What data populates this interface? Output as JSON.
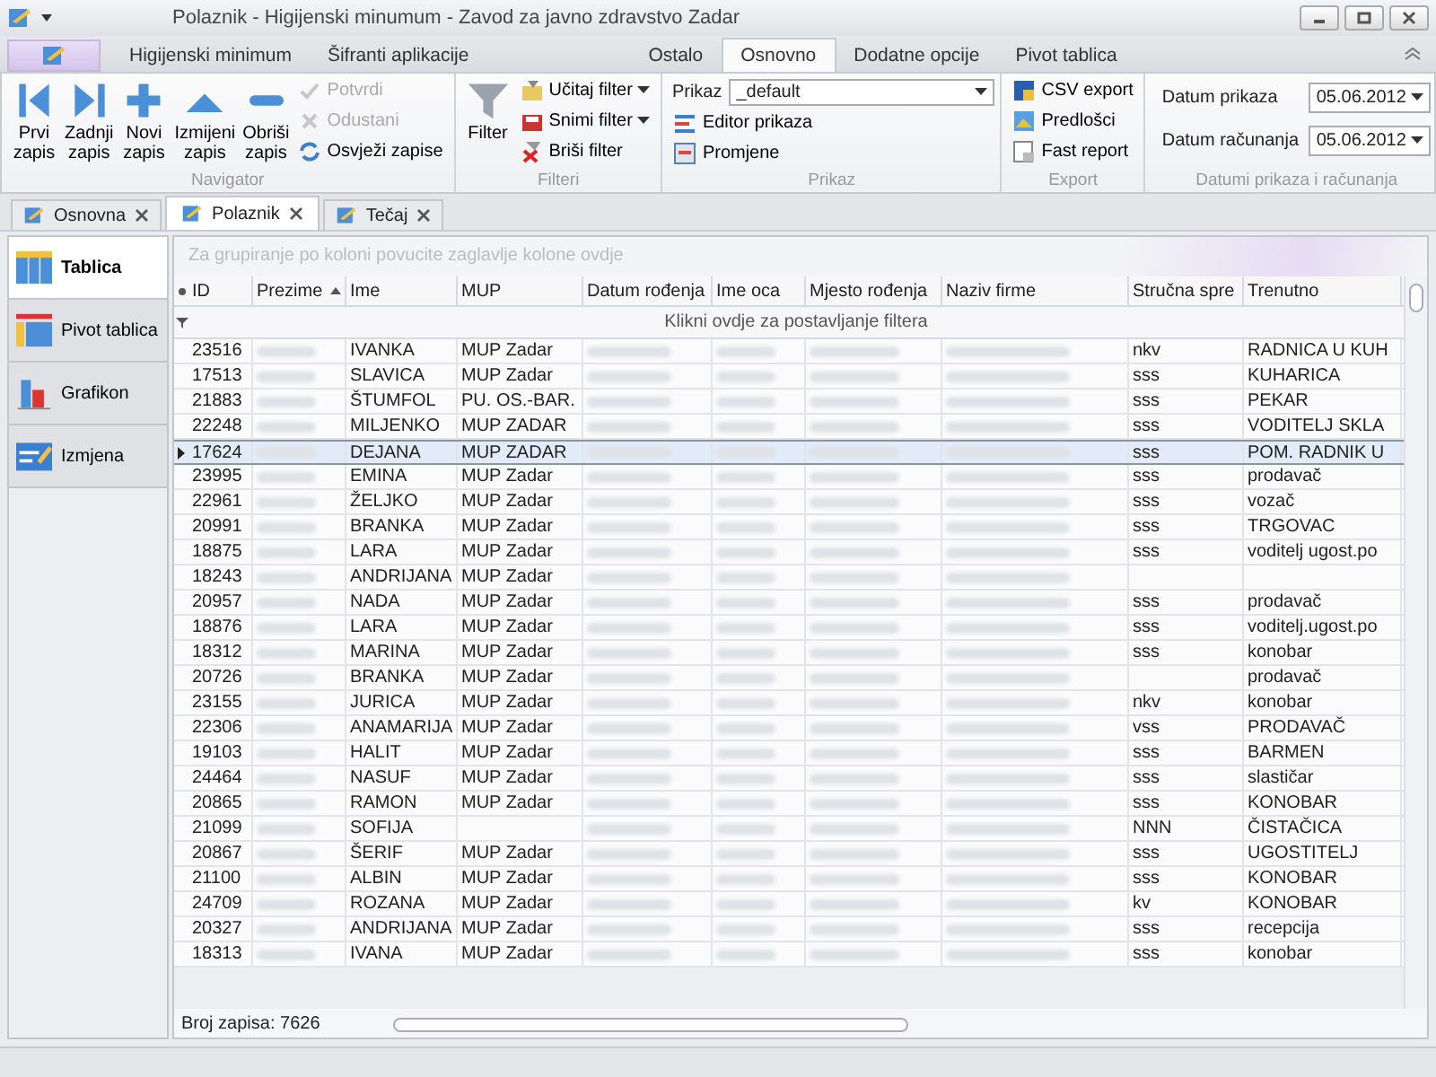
{
  "window": {
    "title": "Polaznik - Higijenski minumum - Zavod za javno zdravstvo Zadar"
  },
  "ribbon_tabs": [
    {
      "label": "Higijenski minimum",
      "selected": false
    },
    {
      "label": "Šifranti aplikacije",
      "selected": false
    },
    {
      "label": "Ostalo",
      "selected": false
    },
    {
      "label": "Osnovno",
      "selected": true
    },
    {
      "label": "Dodatne opcije",
      "selected": false
    },
    {
      "label": "Pivot tablica",
      "selected": false
    }
  ],
  "ribbon_groups": [
    {
      "title": "Navigator",
      "items": [
        {
          "kind": "large",
          "label": "Prvi\nzapis",
          "disabled": false
        },
        {
          "kind": "large",
          "label": "Zadnji\nzapis",
          "disabled": false
        },
        {
          "kind": "large",
          "label": "Novi\nzapis",
          "disabled": false
        },
        {
          "kind": "large",
          "label": "Izmijeni\nzapis",
          "disabled": false
        },
        {
          "kind": "large",
          "label": "Obriši\nzapis",
          "disabled": false
        },
        {
          "kind": "small",
          "label": "Potvrdi",
          "disabled": true
        },
        {
          "kind": "small",
          "label": "Odustani",
          "disabled": true
        },
        {
          "kind": "small",
          "label": "Osvježi zapise",
          "disabled": false
        }
      ]
    },
    {
      "title": "Filteri",
      "items": [
        {
          "kind": "large",
          "label": "Filter",
          "disabled": false
        },
        {
          "kind": "menu",
          "label": "Učitaj filter",
          "disabled": false
        },
        {
          "kind": "menu",
          "label": "Snimi filter",
          "disabled": false
        },
        {
          "kind": "small",
          "label": "Briši filter",
          "disabled": false
        }
      ]
    },
    {
      "title": "Prikaz",
      "items": [
        {
          "kind": "combo",
          "label": "Prikaz",
          "value": "_default",
          "disabled": false
        },
        {
          "kind": "small",
          "label": "Editor prikaza",
          "disabled": false
        },
        {
          "kind": "small",
          "label": "Promjene",
          "disabled": false
        }
      ]
    },
    {
      "title": "Export",
      "items": [
        {
          "kind": "small",
          "label": "CSV export",
          "disabled": false
        },
        {
          "kind": "small",
          "label": "Predlošci",
          "disabled": false
        },
        {
          "kind": "small",
          "label": "Fast report",
          "disabled": false
        }
      ]
    },
    {
      "title": "Datumi prikaza i računanja",
      "items": [
        {
          "kind": "date",
          "label": "Datum prikaza",
          "value": "05.06.2012",
          "disabled": false
        },
        {
          "kind": "date",
          "label": "Datum računanja",
          "value": "05.06.2012",
          "disabled": false
        }
      ]
    }
  ],
  "document_tabs": [
    {
      "label": "Osnovna",
      "selected": false
    },
    {
      "label": "Polaznik",
      "selected": true
    },
    {
      "label": "Tečaj",
      "selected": false
    }
  ],
  "view_buttons": [
    {
      "label": "Tablica",
      "selected": true
    },
    {
      "label": "Pivot tablica",
      "selected": false
    },
    {
      "label": "Grafikon",
      "selected": false
    },
    {
      "label": "Izmjena",
      "selected": false
    }
  ],
  "grid": {
    "group_panel": "Za grupiranje po koloni povucite zaglavlje kolone ovdje",
    "filter_row": "Klikni ovdje za postavljanje filtera",
    "columns": [
      {
        "label": "ID",
        "masked": false,
        "sorted": false
      },
      {
        "label": "Prezime",
        "masked": true,
        "sorted": true
      },
      {
        "label": "Ime",
        "masked": false,
        "sorted": false
      },
      {
        "label": "MUP",
        "masked": false,
        "sorted": false
      },
      {
        "label": "Datum rođenja",
        "masked": true,
        "sorted": false
      },
      {
        "label": "Ime oca",
        "masked": true,
        "sorted": false
      },
      {
        "label": "Mjesto rođenja",
        "masked": true,
        "sorted": false
      },
      {
        "label": "Naziv firme",
        "masked": true,
        "sorted": false
      },
      {
        "label": "Stručna spre",
        "masked": false,
        "sorted": false
      },
      {
        "label": "Trenutno",
        "masked": false,
        "sorted": false
      }
    ],
    "rows": [
      {
        "selected": false,
        "cells": [
          "23516",
          "",
          "IVANKA",
          "MUP Zadar",
          "",
          "",
          "",
          "",
          "nkv",
          "RADNICA U KUH"
        ]
      },
      {
        "selected": false,
        "cells": [
          "17513",
          "",
          "SLAVICA",
          "MUP Zadar",
          "",
          "",
          "",
          "",
          "sss",
          "KUHARICA"
        ]
      },
      {
        "selected": false,
        "cells": [
          "21883",
          "",
          "ŠTUMFOL",
          "PU. OS.-BAR.",
          "",
          "",
          "",
          "",
          "sss",
          "PEKAR"
        ]
      },
      {
        "selected": false,
        "cells": [
          "22248",
          "",
          "MILJENKO",
          "MUP ZADAR",
          "",
          "",
          "",
          "",
          "sss",
          "VODITELJ SKLA"
        ]
      },
      {
        "selected": true,
        "cells": [
          "17624",
          "",
          "DEJANA",
          "MUP  ZADAR",
          "",
          "",
          "",
          "",
          "sss",
          "POM. RADNIK U"
        ]
      },
      {
        "selected": false,
        "cells": [
          "23995",
          "",
          "EMINA",
          "MUP Zadar",
          "",
          "",
          "",
          "",
          "sss",
          "prodavač"
        ]
      },
      {
        "selected": false,
        "cells": [
          "22961",
          "",
          "ŽELJKO",
          "MUP Zadar",
          "",
          "",
          "",
          "",
          "sss",
          "vozač"
        ]
      },
      {
        "selected": false,
        "cells": [
          "20991",
          "",
          "BRANKA",
          "MUP Zadar",
          "",
          "",
          "",
          "",
          "sss",
          "TRGOVAC"
        ]
      },
      {
        "selected": false,
        "cells": [
          "18875",
          "",
          "LARA",
          "MUP Zadar",
          "",
          "",
          "",
          "",
          "sss",
          "voditelj ugost.po"
        ]
      },
      {
        "selected": false,
        "cells": [
          "18243",
          "",
          "ANDRIJANA",
          "MUP Zadar",
          "",
          "",
          "",
          "",
          "",
          ""
        ]
      },
      {
        "selected": false,
        "cells": [
          "20957",
          "",
          "NADA",
          "MUP Zadar",
          "",
          "",
          "",
          "",
          "sss",
          "prodavač"
        ]
      },
      {
        "selected": false,
        "cells": [
          "18876",
          "",
          "LARA",
          "MUP Zadar",
          "",
          "",
          "",
          "",
          "sss",
          "voditelj.ugost.po"
        ]
      },
      {
        "selected": false,
        "cells": [
          "18312",
          "",
          "MARINA",
          "MUP Zadar",
          "",
          "",
          "",
          "",
          "sss",
          "konobar"
        ]
      },
      {
        "selected": false,
        "cells": [
          "20726",
          "",
          "BRANKA",
          "MUP Zadar",
          "",
          "",
          "",
          "",
          "",
          "prodavač"
        ]
      },
      {
        "selected": false,
        "cells": [
          "23155",
          "",
          "JURICA",
          "MUP Zadar",
          "",
          "",
          "",
          "",
          "nkv",
          "konobar"
        ]
      },
      {
        "selected": false,
        "cells": [
          "22306",
          "",
          "ANAMARIJA",
          "MUP Zadar",
          "",
          "",
          "",
          "",
          "vss",
          "PRODAVAČ"
        ]
      },
      {
        "selected": false,
        "cells": [
          "19103",
          "",
          "HALIT",
          "MUP Zadar",
          "",
          "",
          "",
          "",
          "sss",
          "BARMEN"
        ]
      },
      {
        "selected": false,
        "cells": [
          "24464",
          "",
          "NASUF",
          "MUP Zadar",
          "",
          "",
          "",
          "",
          "sss",
          "slastičar"
        ]
      },
      {
        "selected": false,
        "cells": [
          "20865",
          "",
          "RAMON",
          "MUP Zadar",
          "",
          "",
          "",
          "",
          "sss",
          "KONOBAR"
        ]
      },
      {
        "selected": false,
        "cells": [
          "21099",
          "",
          "SOFIJA",
          "",
          "",
          "",
          "",
          "",
          "NNN",
          "ČISTAČICA"
        ]
      },
      {
        "selected": false,
        "cells": [
          "20867",
          "",
          "ŠERIF",
          "MUP Zadar",
          "",
          "",
          "",
          "",
          "sss",
          "UGOSTITELJ"
        ]
      },
      {
        "selected": false,
        "cells": [
          "21100",
          "",
          "ALBIN",
          "MUP Zadar",
          "",
          "",
          "",
          "",
          "sss",
          "KONOBAR"
        ]
      },
      {
        "selected": false,
        "cells": [
          "24709",
          "",
          "ROZANA",
          "MUP Zadar",
          "",
          "",
          "",
          "",
          "kv",
          "KONOBAR"
        ]
      },
      {
        "selected": false,
        "cells": [
          "20327",
          "",
          "ANDRIJANA",
          "MUP Zadar",
          "",
          "",
          "",
          "",
          "sss",
          "recepcija"
        ]
      },
      {
        "selected": false,
        "cells": [
          "18313",
          "",
          "IVANA",
          "MUP Zadar",
          "",
          "",
          "",
          "",
          "sss",
          "konobar"
        ]
      }
    ],
    "record_count": "Broj zapisa: 7626"
  }
}
